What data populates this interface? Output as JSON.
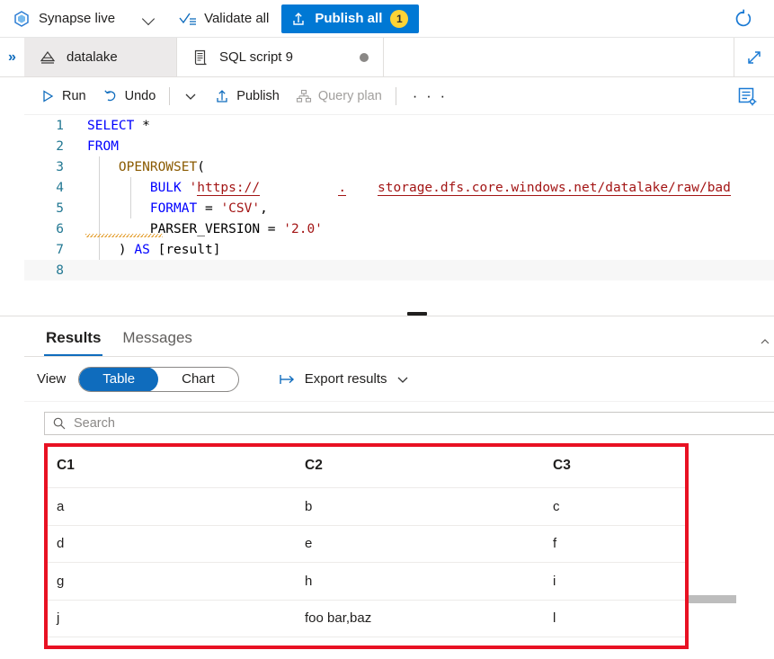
{
  "topbar": {
    "mode_label": "Synapse live",
    "mode_icon": "synapse-hexagon-icon",
    "mode_chevron_icon": "chevron-down-icon",
    "validate_all_label": "Validate all",
    "validate_all_icon": "validate-checklist-icon",
    "publish_all_label": "Publish all",
    "publish_all_icon": "publish-upload-icon",
    "publish_all_badge": "1",
    "publish_all_color": "#0078d4",
    "badge_color": "#ffd335",
    "refresh_icon": "refresh-icon"
  },
  "tabstrip": {
    "sidebar_expand_icon": "double-chevron-right-icon",
    "tabs": [
      {
        "label": "datalake",
        "icon": "database-icon",
        "active": false,
        "dirty": false
      },
      {
        "label": "SQL script 9",
        "icon": "sql-script-icon",
        "active": true,
        "dirty": true
      }
    ],
    "expand_icon": "expand-diagonal-icon"
  },
  "script_toolbar": {
    "run_label": "Run",
    "run_icon": "play-triangle-icon",
    "undo_label": "Undo",
    "undo_icon": "undo-arrow-icon",
    "undo_chevron_icon": "chevron-down-icon",
    "publish_label": "Publish",
    "publish_icon": "publish-upload-icon",
    "query_plan_label": "Query plan",
    "query_plan_icon": "query-plan-hierarchy-icon",
    "query_plan_disabled": true,
    "more_label": "· · ·",
    "properties_icon": "properties-panel-icon"
  },
  "editor": {
    "lines": [
      {
        "number": "1",
        "tokens": [
          {
            "text": "SELECT",
            "style": "k-blue"
          },
          {
            "text": " *",
            "style": "k-plain"
          }
        ]
      },
      {
        "number": "2",
        "tokens": [
          {
            "text": "FROM",
            "style": "k-blue"
          }
        ]
      },
      {
        "number": "3",
        "tokens": [
          {
            "text": "    ",
            "style": "k-plain"
          },
          {
            "text": "OPENROWSET",
            "style": "k-brown"
          },
          {
            "text": "(",
            "style": "k-plain"
          }
        ]
      },
      {
        "number": "4",
        "tokens": [
          {
            "text": "        ",
            "style": "k-plain"
          },
          {
            "text": "BULK",
            "style": "k-blue"
          },
          {
            "text": " ",
            "style": "k-plain"
          },
          {
            "text": "'",
            "style": "k-str"
          },
          {
            "text": "https://",
            "style": "url-link"
          },
          {
            "text": "__________",
            "style": "redact"
          },
          {
            "text": ".",
            "style": "url-link"
          },
          {
            "text": "____",
            "style": "redact"
          },
          {
            "text": "storage.dfs.core.windows.net/datalake/raw/bad",
            "style": "url-link"
          }
        ]
      },
      {
        "number": "5",
        "tokens": [
          {
            "text": "        ",
            "style": "k-plain"
          },
          {
            "text": "FORMAT",
            "style": "k-blue"
          },
          {
            "text": " = ",
            "style": "k-plain"
          },
          {
            "text": "'CSV'",
            "style": "k-str"
          },
          {
            "text": ",",
            "style": "k-plain"
          }
        ]
      },
      {
        "number": "6",
        "tokens": [
          {
            "text": "        ",
            "style": "k-plain"
          },
          {
            "text": "PARSER_VERSION",
            "style": "k-plain"
          },
          {
            "text": " = ",
            "style": "k-plain"
          },
          {
            "text": "'2.0'",
            "style": "k-str"
          }
        ]
      },
      {
        "number": "7",
        "tokens": [
          {
            "text": "    ",
            "style": "k-plain"
          },
          {
            "text": ") ",
            "style": "k-plain"
          },
          {
            "text": "AS",
            "style": "k-blue"
          },
          {
            "text": " [result]",
            "style": "k-plain"
          }
        ]
      },
      {
        "number": "8",
        "tokens": [],
        "current": true
      }
    ]
  },
  "results": {
    "tabs": [
      {
        "label": "Results",
        "active": true
      },
      {
        "label": "Messages",
        "active": false
      }
    ],
    "collapse_icon": "chevron-up-icon",
    "view_label": "View",
    "view_options": [
      {
        "label": "Table",
        "selected": true
      },
      {
        "label": "Chart",
        "selected": false
      }
    ],
    "export_label": "Export results",
    "export_icon": "export-arrow-icon",
    "export_chevron_icon": "chevron-down-icon",
    "search_placeholder": "Search",
    "search_value": "",
    "search_icon": "search-icon",
    "accent_color": "#0f6cbd",
    "highlight_color": "#e81123",
    "table": {
      "columns": [
        "C1",
        "C2",
        "C3"
      ],
      "rows": [
        [
          "a",
          "b",
          "c"
        ],
        [
          "d",
          "e",
          "f"
        ],
        [
          "g",
          "h",
          "i"
        ],
        [
          "j",
          "foo bar,baz",
          "l"
        ]
      ]
    }
  }
}
